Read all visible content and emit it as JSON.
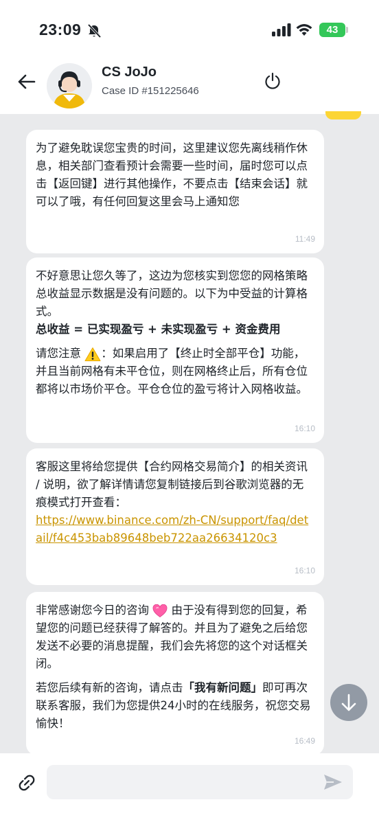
{
  "status_bar": {
    "time": "23:09",
    "battery": "43",
    "icons": [
      "bell-muted-icon",
      "signal-icon",
      "wifi-icon",
      "battery-charging-icon"
    ]
  },
  "header": {
    "agent_name": "CS JoJo",
    "case_id": "Case ID #151225646",
    "icons": [
      "back-arrow-icon",
      "agent-avatar",
      "power-icon"
    ]
  },
  "messages": [
    {
      "paragraphs": [
        "为了避免耽误您宝贵的时间，这里建议您先离线稍作休息，相关部门查看预计会需要一些时间，届时您可以点击【返回键】进行其他操作，不要点击【结束会话】就可以了哦，有任何回复这里会马上通知您"
      ],
      "time": "11:49"
    },
    {
      "p1": "不好意思让您久等了，这边为您核实到您您的网格策略总收益显示数据是没有问题的。以下为中受益的计算格式。",
      "formula": "总收益 = 已实现盈亏 + 未实现盈亏 + 资金费用",
      "p2_before": "请您注意",
      "p2_after": "：如果启用了【终止时全部平仓】功能，并且当前网格有未平仓位，则在网格终止后，所有仓位都将以市场价平仓。平仓仓位的盈亏将计入网格收益。",
      "time": "16:10"
    },
    {
      "text": "客服这里将给您提供【合约网格交易简介】的相关资讯 / 说明，欲了解详情请您复制链接后到谷歌浏览器的无痕模式打开查看：",
      "link": "https://www.binance.com/zh-CN/support/faq/detail/f4c453bab89648beb722aa26634120c3",
      "time": "16:10"
    },
    {
      "p1_before": "非常感谢您今日的咨询",
      "p1_after": "由于没有得到您的回复，希望您的问题已经获得了解答的。并且为了避免之后给您发送不必要的消息提醒，我们会先将您的这个对话框关闭。",
      "p2_before": "若您后续有新的咨询，请点击",
      "p2_bold": "「我有新问题」",
      "p2_after": "即可再次联系客服，我们为您提供24小时的在线服务，祝您交易愉快！",
      "time": "16:49"
    }
  ],
  "input": {
    "value": "",
    "placeholder": ""
  },
  "colors": {
    "accent": "#fcd535",
    "link": "#c99400",
    "background": "#e9eaec"
  }
}
